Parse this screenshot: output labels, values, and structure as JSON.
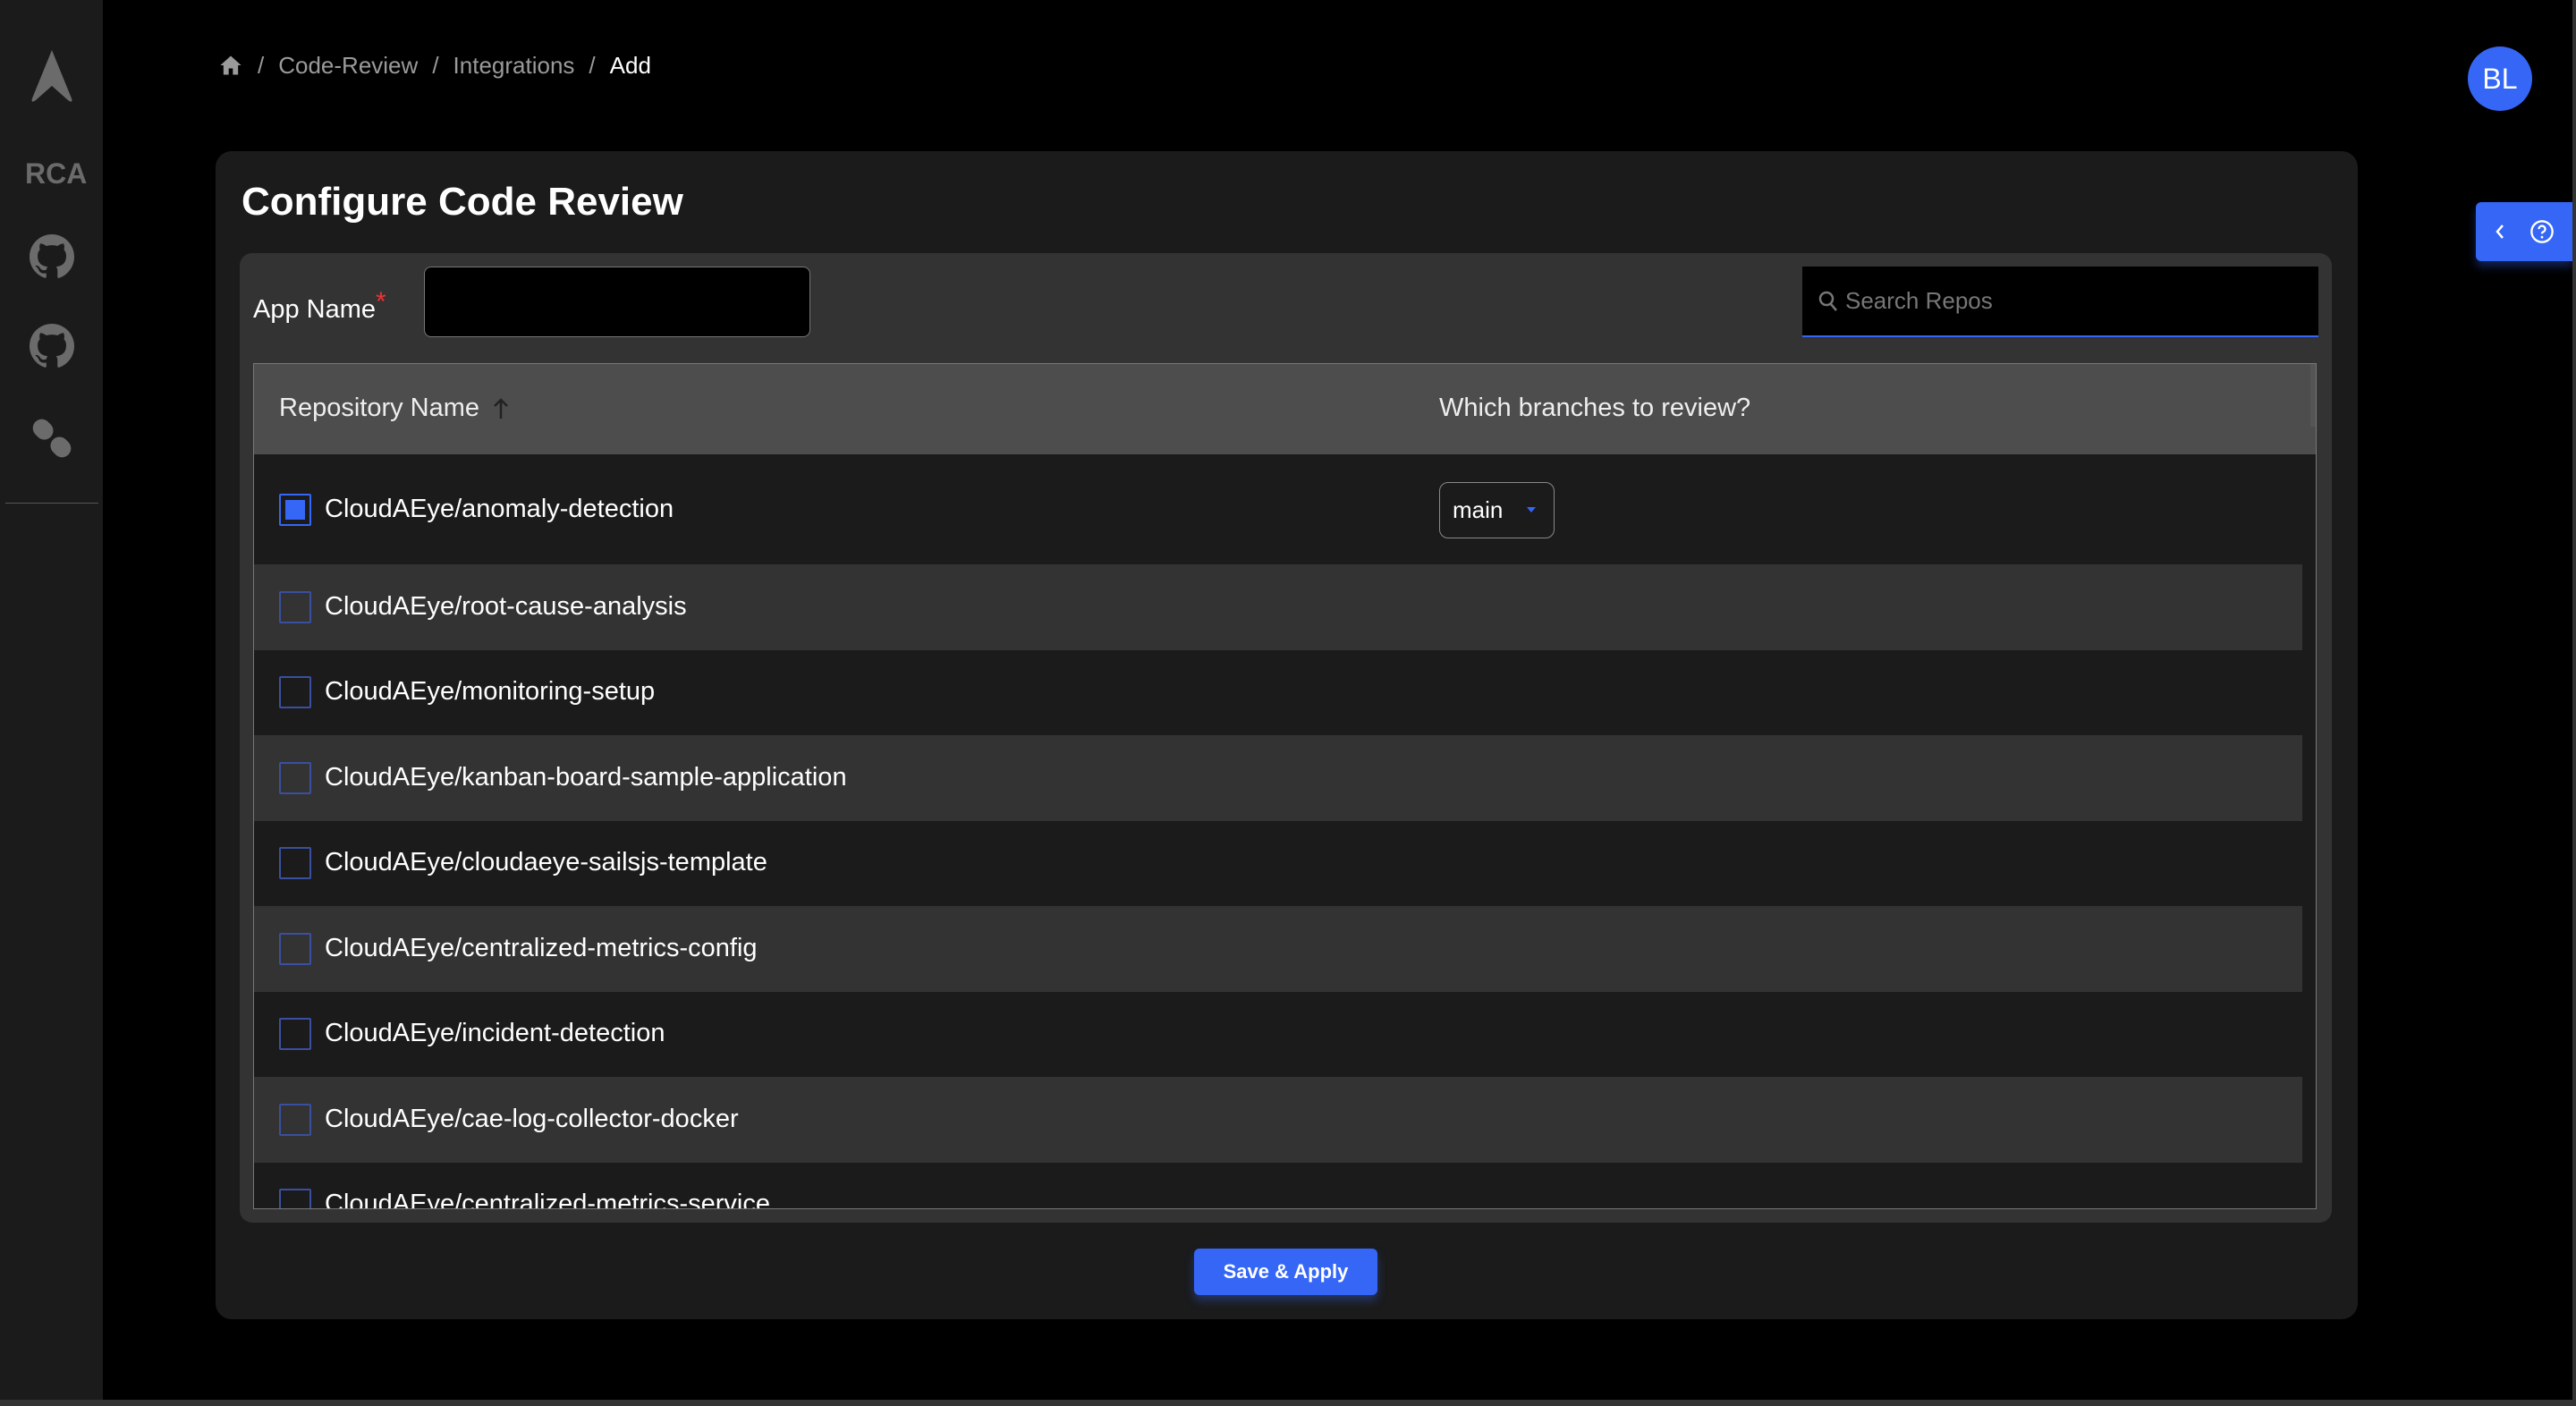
{
  "sidebar": {
    "logo": "arrow-logo",
    "items": [
      {
        "label": "RCA"
      },
      {
        "icon": "github-icon"
      },
      {
        "icon": "github-icon"
      },
      {
        "icon": "pill-icon"
      }
    ]
  },
  "breadcrumb": {
    "items": [
      "Code-Review",
      "Integrations",
      "Add"
    ]
  },
  "avatar": {
    "initials": "BL"
  },
  "title": "Configure Code Review",
  "form": {
    "app_name_label": "App Name",
    "required_mark": "*",
    "app_name_value": "",
    "search_placeholder": "Search Repos"
  },
  "table": {
    "columns": [
      "Repository Name",
      "Which branches to review?"
    ],
    "sort": "ascending",
    "rows": [
      {
        "name": "CloudAEye/anomaly-detection",
        "checked": true,
        "branch": "main"
      },
      {
        "name": "CloudAEye/root-cause-analysis",
        "checked": false
      },
      {
        "name": "CloudAEye/monitoring-setup",
        "checked": false
      },
      {
        "name": "CloudAEye/kanban-board-sample-application",
        "checked": false
      },
      {
        "name": "CloudAEye/cloudaeye-sailsjs-template",
        "checked": false
      },
      {
        "name": "CloudAEye/centralized-metrics-config",
        "checked": false
      },
      {
        "name": "CloudAEye/incident-detection",
        "checked": false
      },
      {
        "name": "CloudAEye/cae-log-collector-docker",
        "checked": false
      },
      {
        "name": "CloudAEye/centralized-metrics-service",
        "checked": false
      }
    ]
  },
  "save_label": "Save & Apply",
  "colors": {
    "accent": "#3566f6",
    "card": "#1b1b1b",
    "panel": "#333333",
    "header": "#4d4d4d"
  }
}
